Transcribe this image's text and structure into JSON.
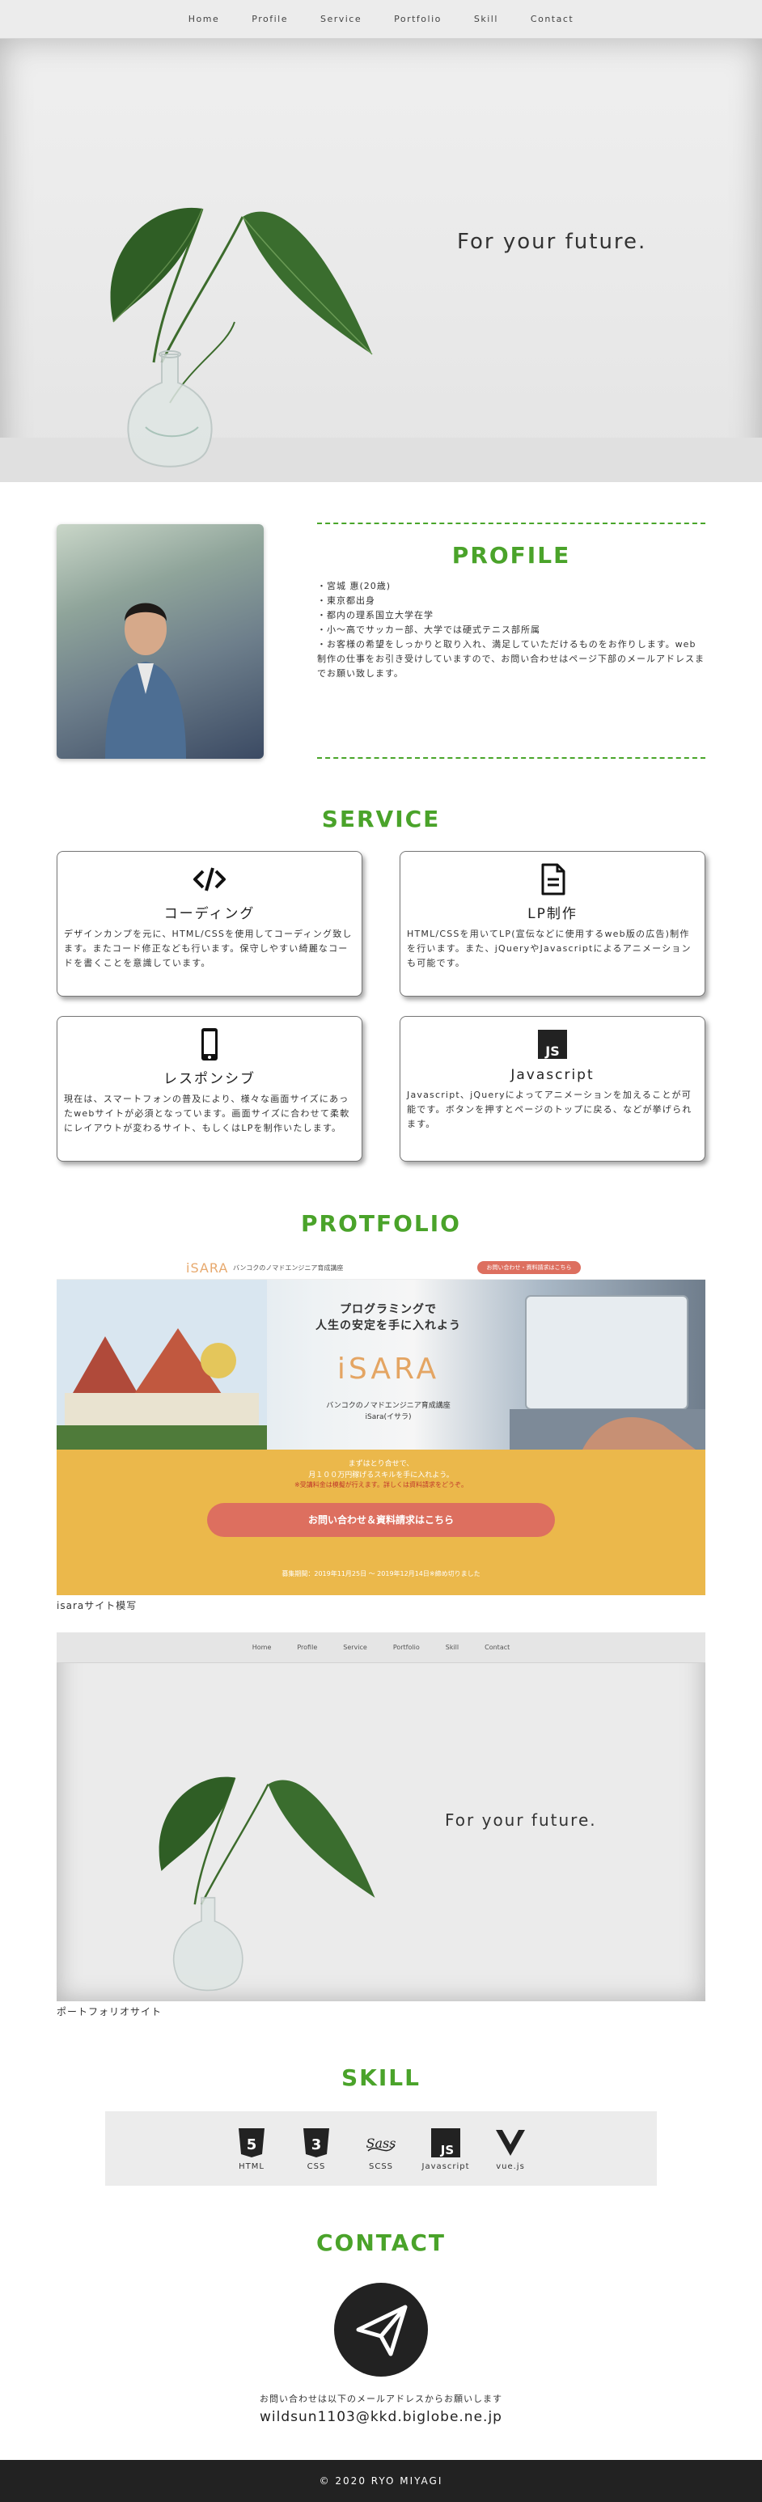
{
  "nav": {
    "items": [
      "Home",
      "Profile",
      "Service",
      "Portfolio",
      "Skill",
      "Contact"
    ]
  },
  "hero": {
    "tagline": "For your future."
  },
  "profile": {
    "title": "PROFILE",
    "lines": [
      "・宮城 惠(20歳)",
      "・東京都出身",
      "・都内の理系国立大学在学",
      "・小〜高でサッカー部、大学では硬式テニス部所属",
      "・お客様の希望をしっかりと取り入れ、満足していただけるものをお作りします。web制作の仕事をお引き受けしていますので、お問い合わせはページ下部のメールアドレスまでお願い致します。"
    ]
  },
  "service": {
    "title": "SERVICE",
    "cards": [
      {
        "icon": "code-icon",
        "title": "コーディング",
        "desc": "デザインカンプを元に、HTML/CSSを使用してコーディング致します。またコード修正なども行います。保守しやすい綺麗なコードを書くことを意識しています。"
      },
      {
        "icon": "document-icon",
        "title": "LP制作",
        "desc": "HTML/CSSを用いてLP(宣伝などに使用するweb版の広告)制作を行います。また、jQueryやJavascriptによるアニメーションも可能です。"
      },
      {
        "icon": "smartphone-icon",
        "title": "レスポンシブ",
        "desc": "現在は、スマートフォンの普及により、様々な画面サイズにあったwebサイトが必須となっています。画面サイズに合わせて柔軟にレイアウトが変わるサイト、もしくはLPを制作いたします。"
      },
      {
        "icon": "javascript-icon",
        "title": "Javascript",
        "desc": "Javascript、jQueryによってアニメーションを加えることが可能です。ボタンを押すとページのトップに戻る、などが挙げられます。"
      }
    ]
  },
  "portfolio": {
    "title": "PROTFOLIO",
    "items": [
      {
        "caption": "isaraサイト模写",
        "logo": "iSARA",
        "logo_sub": "バンコクのノマドエンジニア育成講座",
        "header_button": "お問い合わせ・資料請求はこちら",
        "headline1": "プログラミングで",
        "headline2": "人生の安定を手に入れよう",
        "brand": "iSARA",
        "sub1": "バンコクのノマドエンジニア育成講座",
        "sub2": "iSara(イサラ)",
        "offer1": "まずはとり合せで、",
        "offer2": "月１００万円稼げるスキルを手に入れよう。",
        "offer3": "※受講料金は模擬が行えます。詳しくは資料請求をどうぞ。",
        "cta": "お問い合わせ＆資料請求はこちら",
        "period": "募集期間：2019年11月25日 〜 2019年12月14日※締め切りました"
      },
      {
        "caption": "ポートフォリオサイト",
        "nav": [
          "Home",
          "Profile",
          "Service",
          "Portfolio",
          "Skill",
          "Contact"
        ],
        "tagline": "For your future."
      }
    ]
  },
  "skill": {
    "title": "SKILL",
    "items": [
      {
        "icon": "html5-icon",
        "label": "HTML"
      },
      {
        "icon": "css3-icon",
        "label": "CSS"
      },
      {
        "icon": "sass-icon",
        "label": "SCSS"
      },
      {
        "icon": "javascript-icon",
        "label": "Javascript"
      },
      {
        "icon": "vuejs-icon",
        "label": "vue.js"
      }
    ]
  },
  "contact": {
    "title": "CONTACT",
    "note": "お問い合わせは以下のメールアドレスからお願いします",
    "email": "wildsun1103@kkd.biglobe.ne.jp"
  },
  "footer": {
    "copyright": "© 2020 RYO MIYAGI"
  },
  "colors": {
    "accent": "#4aa32a",
    "footer_bg": "#222222",
    "isara_yellow": "#ebb84b",
    "isara_red": "#dd6f5f"
  }
}
